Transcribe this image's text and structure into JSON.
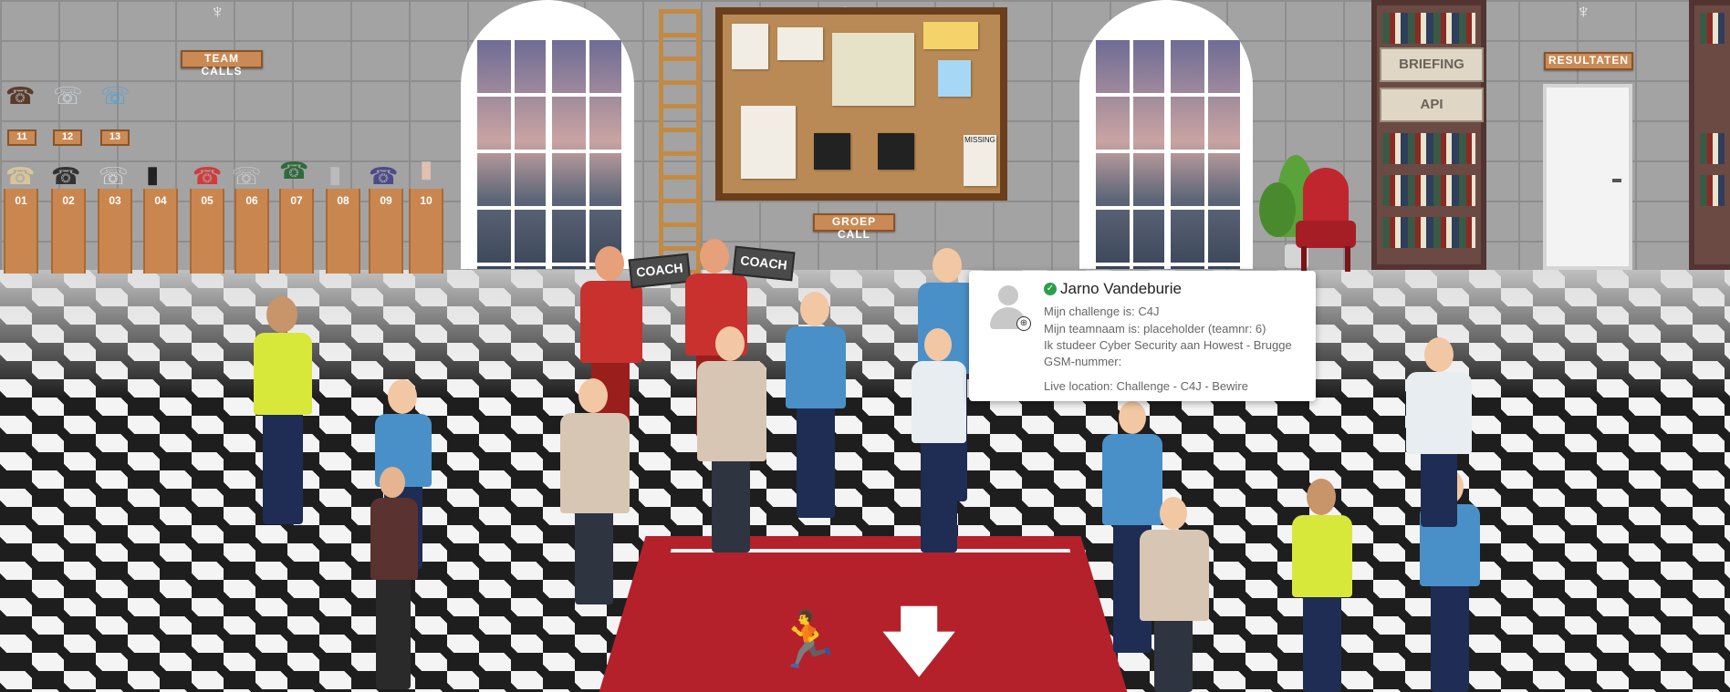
{
  "hall": {
    "team_calls_label": "TEAM CALLS",
    "group_call_label": "GROEP CALL",
    "results_label": "RESULTATEN",
    "briefing_label": "BRIEFING",
    "api_label": "API",
    "team_booths_top": [
      "11",
      "12",
      "13"
    ],
    "team_booths": [
      "01",
      "02",
      "03",
      "04",
      "05",
      "06",
      "07",
      "08",
      "09",
      "10"
    ],
    "coach_sign_1": "COACH",
    "coach_sign_2": "COACH",
    "missing_poster": "MISSING",
    "icons": {
      "exit": "exit-running-man-icon",
      "arrow": "arrow-down-icon",
      "phone": "telephone-icon",
      "globe": "globe-icon",
      "check": "check-circle-icon"
    },
    "colors": {
      "rug": "#b4212b",
      "plaque": "#c98a55",
      "online": "#2e9e4a"
    }
  },
  "profile_card": {
    "name": "Jarno Vandeburie",
    "challenge": "Mijn challenge is: C4J",
    "team": "Mijn teamnaam is: placeholder (teamnr: 6)",
    "study": "Ik studeer Cyber Security aan Howest - Brugge",
    "phone": "GSM-nummer:",
    "location": "Live location: Challenge - C4J - Bewire"
  }
}
